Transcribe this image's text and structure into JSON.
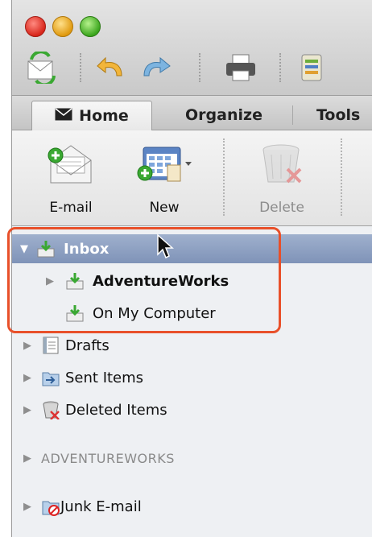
{
  "window": {
    "traffic_lights": [
      "close",
      "minimize",
      "zoom"
    ],
    "toolbar_icons": [
      "send-receive-icon",
      "undo-icon",
      "redo-icon",
      "print-icon",
      "notebook-icon"
    ]
  },
  "ribbon": {
    "tabs": [
      {
        "label": "Home",
        "icon": "envelope-icon",
        "active": true
      },
      {
        "label": "Organize",
        "active": false
      },
      {
        "label": "Tools",
        "active": false
      }
    ],
    "buttons": [
      {
        "label": "E-mail",
        "icon": "new-email-icon",
        "enabled": true
      },
      {
        "label": "New",
        "icon": "new-items-icon",
        "enabled": true
      },
      {
        "label": "Delete",
        "icon": "delete-icon",
        "enabled": false
      }
    ]
  },
  "folders": {
    "inbox": {
      "label": "Inbox",
      "expanded": true,
      "selected": true
    },
    "inbox_children": [
      {
        "label": "AdventureWorks",
        "bold": true,
        "expandable": true
      },
      {
        "label": "On My Computer",
        "bold": false,
        "expandable": false
      }
    ],
    "items": [
      {
        "label": "Drafts",
        "icon": "drafts-icon"
      },
      {
        "label": "Sent Items",
        "icon": "sent-items-icon"
      },
      {
        "label": "Deleted Items",
        "icon": "deleted-items-icon"
      }
    ],
    "account_section": "ADVENTUREWORKS",
    "account_items": [
      {
        "label": "Junk E-mail",
        "icon": "junk-email-icon"
      }
    ]
  },
  "colors": {
    "highlight": "#e8502a",
    "selection": "#8a9dc0"
  }
}
